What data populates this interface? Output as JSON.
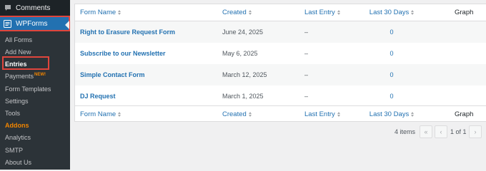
{
  "sidebar": {
    "comments_label": "Comments",
    "wpforms_label": "WPForms",
    "items": [
      {
        "label": "All Forms"
      },
      {
        "label": "Add New"
      },
      {
        "label": "Entries"
      },
      {
        "label": "Payments",
        "badge": "NEW!"
      },
      {
        "label": "Form Templates"
      },
      {
        "label": "Settings"
      },
      {
        "label": "Tools"
      },
      {
        "label": "Addons"
      },
      {
        "label": "Analytics"
      },
      {
        "label": "SMTP"
      },
      {
        "label": "About Us"
      }
    ]
  },
  "table": {
    "columns": [
      "Form Name",
      "Created",
      "Last Entry",
      "Last 30 Days",
      "Graph"
    ],
    "rows": [
      {
        "name": "Right to Erasure Request Form",
        "created": "June 24, 2025",
        "last_entry": "–",
        "last_30": "0"
      },
      {
        "name": "Subscribe to our Newsletter",
        "created": "May 6, 2025",
        "last_entry": "–",
        "last_30": "0"
      },
      {
        "name": "Simple Contact Form",
        "created": "March 12, 2025",
        "last_entry": "–",
        "last_30": "0"
      },
      {
        "name": "DJ Request",
        "created": "March 1, 2025",
        "last_entry": "–",
        "last_30": "0"
      }
    ]
  },
  "pagination": {
    "items_count": "4 items",
    "first": "«",
    "prev": "‹",
    "page_of": "1 of 1",
    "next": "›"
  },
  "colors": {
    "sidebar_bg": "#1d2327",
    "submenu_bg": "#2c3338",
    "active_blue": "#2271b1",
    "highlight_red": "#e0453c",
    "addons_orange": "#f18500"
  }
}
